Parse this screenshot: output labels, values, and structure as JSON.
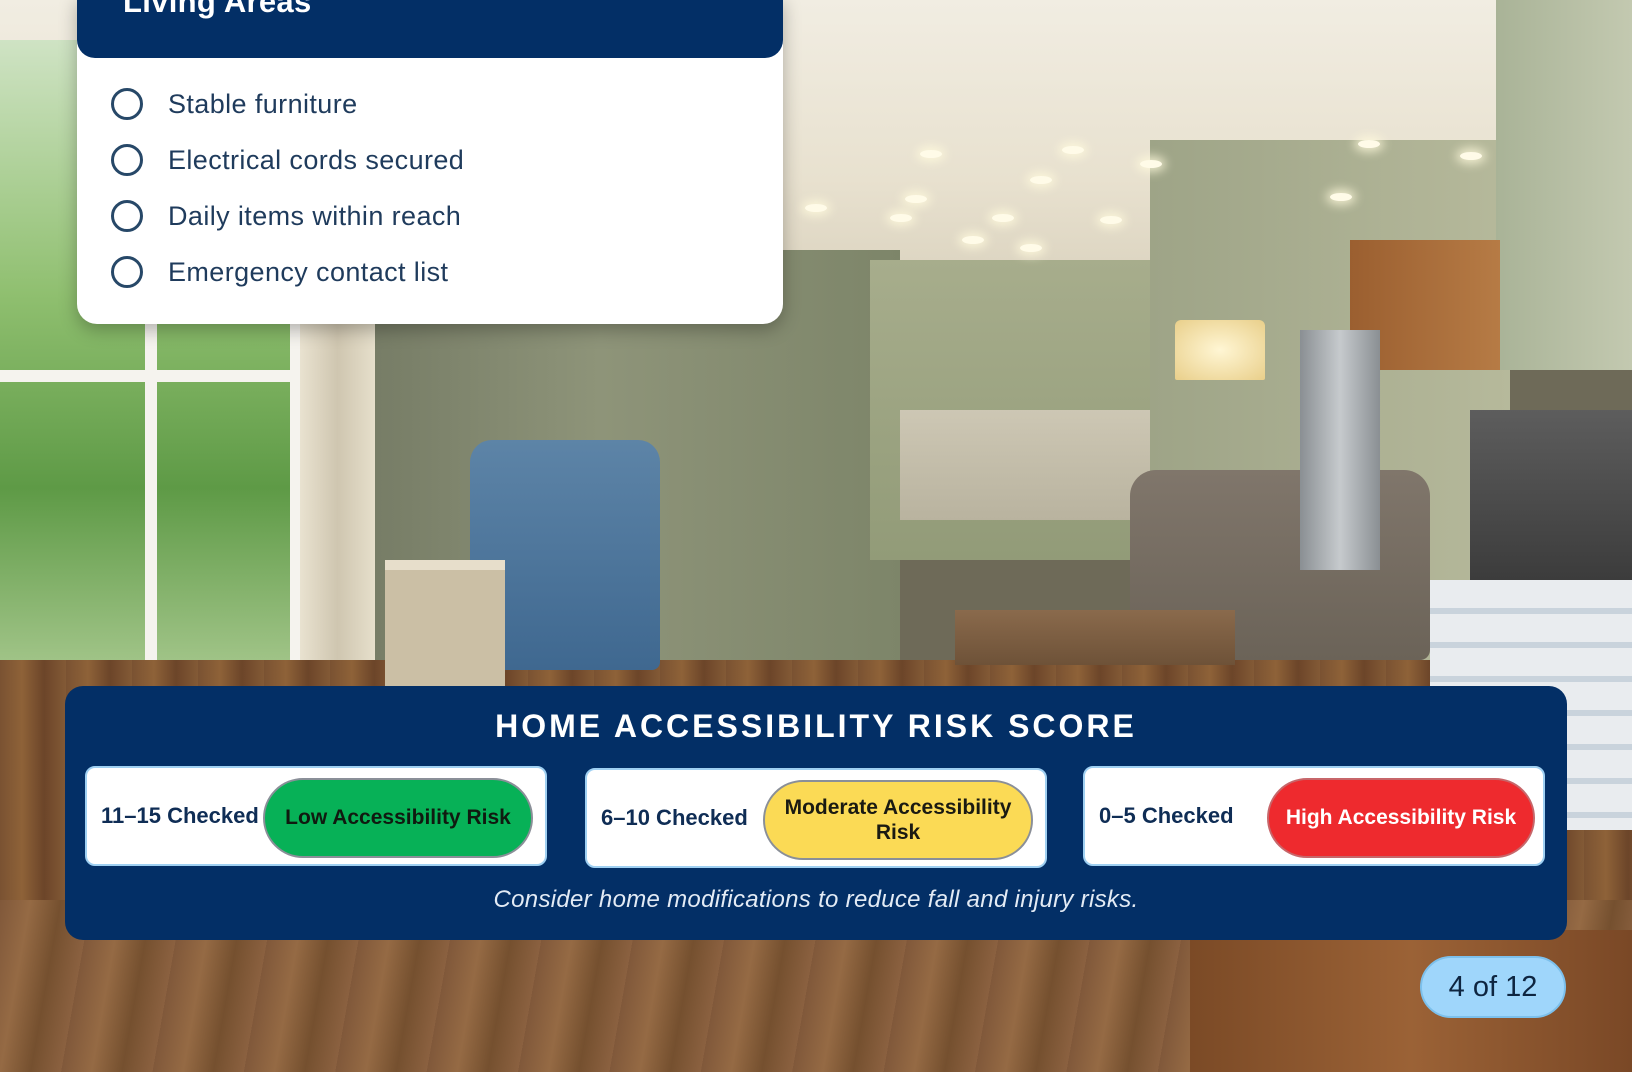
{
  "checklist": {
    "title": "Living Areas",
    "items": [
      {
        "label": "Stable furniture",
        "checked": false
      },
      {
        "label": "Electrical cords secured",
        "checked": false
      },
      {
        "label": "Daily items within reach",
        "checked": false
      },
      {
        "label": "Emergency contact list",
        "checked": false
      }
    ]
  },
  "risk_score": {
    "title": "HOME ACCESSIBILITY RISK SCORE",
    "levels": [
      {
        "range": "11–15 Checked",
        "label": "Low Accessibility Risk",
        "color": "#07b157"
      },
      {
        "range": "6–10 Checked",
        "label": "Moderate Accessibility Risk",
        "color": "#fbda55"
      },
      {
        "range": "0–5 Checked",
        "label": "High Accessibility Risk",
        "color": "#ee2a2e"
      }
    ],
    "note": "Consider home modifications to reduce fall and injury risks."
  },
  "pagination": {
    "label": "4 of 12"
  },
  "colors": {
    "panel": "#032f66",
    "page_indicator": "#9fd6fb"
  }
}
